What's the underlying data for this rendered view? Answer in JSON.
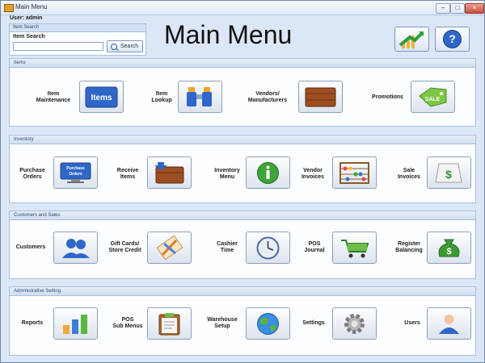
{
  "window": {
    "title": "Main Menu",
    "user_label": "User: admin",
    "controls": [
      "–",
      "□",
      "×"
    ]
  },
  "search": {
    "group_title": "Item Search",
    "label": "Item Search",
    "value": "",
    "placeholder": "",
    "button_label": "Search"
  },
  "page": {
    "title": "Main Menu",
    "top_icons": [
      "chart-up-icon",
      "help-icon"
    ]
  },
  "sections": [
    {
      "title": "Items",
      "items": [
        {
          "label": "Item\nMaintenance",
          "icon": "items-icon"
        },
        {
          "label": "Item\nLookup",
          "icon": "binoculars-icon"
        },
        {
          "label": "Vendors/\nManufacturers",
          "icon": "crate-icon"
        },
        {
          "label": "Promotions",
          "icon": "sale-tag-icon"
        }
      ]
    },
    {
      "title": "Inventory",
      "items": [
        {
          "label": "Purchase\nOrders",
          "icon": "purchase-orders-icon",
          "icon_text": "Purchase\nOrders"
        },
        {
          "label": "Receive\nItems",
          "icon": "receive-crate-icon"
        },
        {
          "label": "Inventory\nMenu",
          "icon": "info-icon"
        },
        {
          "label": "Vendor\nInvoices",
          "icon": "abacus-icon"
        },
        {
          "label": "Sale\nInvoices",
          "icon": "dollar-paper-icon"
        }
      ]
    },
    {
      "title": "Customers and Sales",
      "items": [
        {
          "label": "Customers",
          "icon": "customers-icon"
        },
        {
          "label": "Gift Cards/\nStore Credit",
          "icon": "gift-card-icon"
        },
        {
          "label": "Cashier\nTime",
          "icon": "clock-icon"
        },
        {
          "label": "POS\nJournal",
          "icon": "cart-icon"
        },
        {
          "label": "Register\nBalancing",
          "icon": "money-bag-icon"
        }
      ]
    },
    {
      "title": "Administrative Setting",
      "items": [
        {
          "label": "Reports",
          "icon": "bar-chart-icon"
        },
        {
          "label": "POS\nSub Menus",
          "icon": "clipboard-icon"
        },
        {
          "label": "Warehouse\nSetup",
          "icon": "globe-icon"
        },
        {
          "label": "Settings",
          "icon": "gear-icon"
        },
        {
          "label": "Users",
          "icon": "user-icon"
        }
      ]
    }
  ],
  "colors": {
    "accent": "#2f67c9",
    "panel": "#fbfdff",
    "background": "#dbe7f7"
  }
}
